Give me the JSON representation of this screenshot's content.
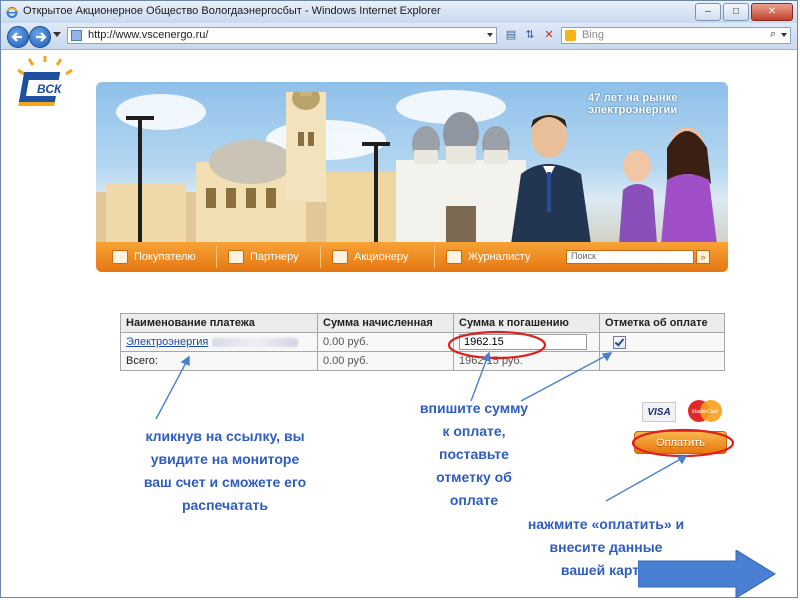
{
  "browser": {
    "window_title": "Открытое Акционерное Общество Вологдаэнергосбыт - Windows Internet Explorer",
    "address_url": "http://www.vscenergo.ru/",
    "search_placeholder": "Bing",
    "window_buttons": [
      "–",
      "□",
      "✕"
    ]
  },
  "logo": {
    "text": "ВСК"
  },
  "banner": {
    "slogan": "47 лет на рынке электроэнергии",
    "menu": [
      {
        "label": "Покупателю",
        "icon": "cart-icon"
      },
      {
        "label": "Партнеру",
        "icon": "briefcase-icon"
      },
      {
        "label": "Акционеру",
        "icon": "chart-icon"
      },
      {
        "label": "Журналисту",
        "icon": "pen-icon"
      }
    ],
    "search_placeholder": "Поиск",
    "search_go": "»"
  },
  "payments_table": {
    "headers": [
      "Наименование платежа",
      "Сумма начисленная",
      "Сумма к погашению",
      "Отметка об оплате"
    ],
    "row": {
      "name": "Электроэнергия",
      "accrued": "0.00 руб.",
      "to_pay": "1962.15",
      "paid_checked": true
    },
    "total": {
      "label": "Всего:",
      "accrued": "0.00 руб.",
      "to_pay": "1962.15 руб."
    }
  },
  "payment": {
    "visa_label": "VISA",
    "mastercard_label": "MasterCard",
    "pay_button": "Оплатить"
  },
  "annotations": {
    "link_hint": [
      "кликнув на ссылку, вы",
      "увидите на мониторе",
      "ваш счет и сможете его",
      "распечатать"
    ],
    "sum_hint": [
      "впишите сумму",
      "к оплате,",
      "поставьте",
      "отметку об",
      "оплате"
    ],
    "pay_hint": [
      "нажмите «оплатить» и",
      "внесите данные",
      "вашей карты"
    ]
  },
  "colors": {
    "annotation": "#2e5cc0",
    "highlight_ring": "#e0201c",
    "menu_orange": "#f29a2e",
    "arrow_blue": "#3a71c8"
  }
}
